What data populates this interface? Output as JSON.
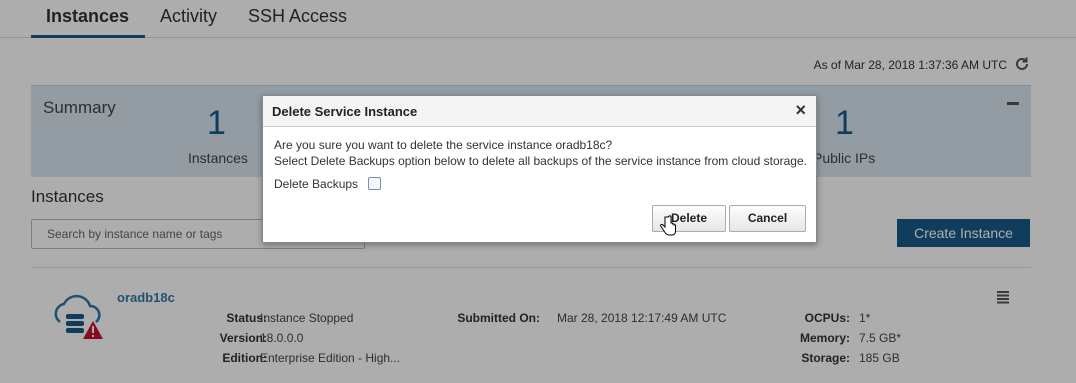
{
  "tabs": [
    {
      "label": "Instances",
      "active": true
    },
    {
      "label": "Activity",
      "active": false
    },
    {
      "label": "SSH Access",
      "active": false
    }
  ],
  "timestamp": "As of Mar 28, 2018 1:37:36 AM UTC",
  "summary": {
    "title": "Summary",
    "stats": [
      {
        "value": "1",
        "label": "Instances"
      },
      {
        "value": "1",
        "label": "Public IPs"
      }
    ]
  },
  "instances_section": {
    "title": "Instances",
    "search_placeholder": "Search by instance name or tags",
    "create_label": "Create Instance"
  },
  "instance": {
    "name": "oradb18c",
    "status_label": "Status:",
    "status": "Instance Stopped",
    "version_label": "Version:",
    "version": "18.0.0.0",
    "edition_label": "Edition:",
    "edition": "Enterprise Edition - High...",
    "submitted_label": "Submitted On:",
    "submitted": "Mar 28, 2018 12:17:49 AM UTC",
    "ocpus_label": "OCPUs:",
    "ocpus": "1*",
    "memory_label": "Memory:",
    "memory": "7.5 GB*",
    "storage_label": "Storage:",
    "storage": "185 GB"
  },
  "dialog": {
    "title": "Delete Service Instance",
    "close": "×",
    "line1": "Are you sure you want to delete the service instance oradb18c?",
    "line2": "Select Delete Backups option below to delete all backups of the service instance from cloud storage.",
    "checkbox_label": "Delete Backups",
    "checkbox_checked": false,
    "delete_label": "Delete",
    "cancel_label": "Cancel"
  },
  "colors": {
    "accent": "#1a5a8a",
    "summary_bg": "#d8e6ef",
    "link": "#2f7aa5",
    "warning": "#c8102e"
  }
}
